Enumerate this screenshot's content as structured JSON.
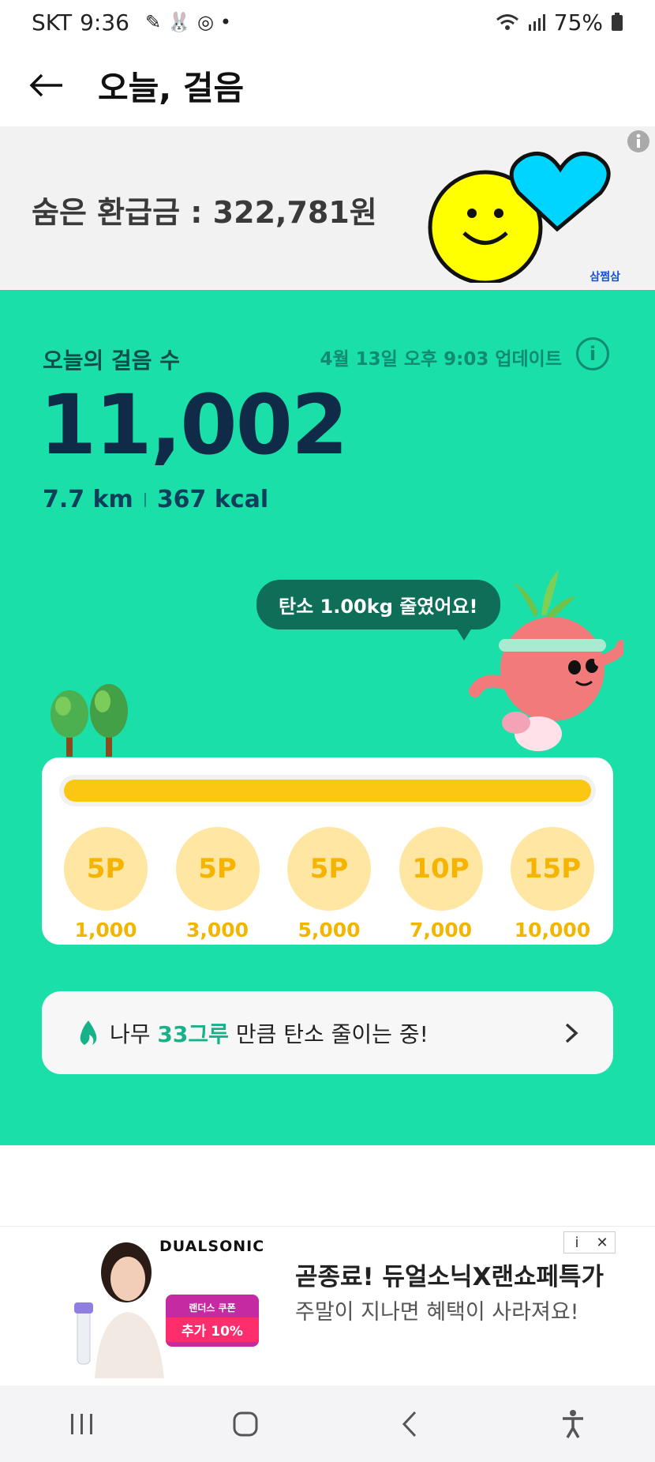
{
  "status_bar": {
    "carrier": "SKT",
    "time": "9:36",
    "battery": "75%",
    "icons": [
      "notification-icon",
      "rabbit-icon",
      "app-icon",
      "dot-icon",
      "wifi-icon",
      "signal-icon",
      "battery-icon"
    ]
  },
  "header": {
    "title": "오늘, 걸음"
  },
  "banner": {
    "refund_text": "숨은 환급금 : 322,781원",
    "brand": "삼쩜삼"
  },
  "steps": {
    "label": "오늘의 걸음 수",
    "updated": "4월 13일 오후 9:03 업데이트",
    "count": "11,002",
    "distance": "7.7 km",
    "calories": "367 kcal",
    "carbon_message": "탄소 1.00kg 줄였어요!"
  },
  "progress": {
    "fraction": 1.0
  },
  "rewards": [
    {
      "points": "5P",
      "steps": "1,000"
    },
    {
      "points": "5P",
      "steps": "3,000"
    },
    {
      "points": "5P",
      "steps": "5,000"
    },
    {
      "points": "10P",
      "steps": "7,000"
    },
    {
      "points": "15P",
      "steps": "10,000"
    }
  ],
  "tree_message": {
    "prefix": "나무 ",
    "highlight": "33그루",
    "suffix": " 만큼 탄소 줄이는 중!"
  },
  "ad": {
    "brand": "DUALSONIC",
    "tag_line1": "랜더스 쿠폰",
    "tag_line2": "추가 10%",
    "title": "곧종료! 듀얼소닉X랜쇼페특가",
    "subtitle": "주말이 지나면 혜택이 사라져요!",
    "info_label": "i",
    "close_label": "✕"
  },
  "colors": {
    "green": "#1adfa8",
    "yellow": "#fcc712",
    "dark_text": "#0f2b47"
  }
}
